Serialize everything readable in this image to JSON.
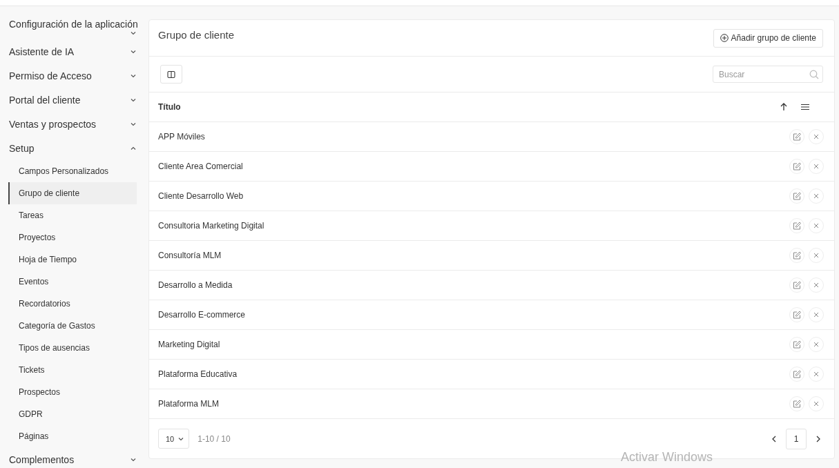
{
  "sidebar": {
    "items": [
      {
        "label": "Configuración de la aplicación",
        "expanded": false
      },
      {
        "label": "Asistente de IA",
        "expanded": false
      },
      {
        "label": "Permiso de Acceso",
        "expanded": false
      },
      {
        "label": "Portal del cliente",
        "expanded": false
      },
      {
        "label": "Ventas y prospectos",
        "expanded": false
      },
      {
        "label": "Setup",
        "expanded": true,
        "children": [
          {
            "label": "Campos Personalizados",
            "selected": false
          },
          {
            "label": "Grupo de cliente",
            "selected": true
          },
          {
            "label": "Tareas",
            "selected": false
          },
          {
            "label": "Proyectos",
            "selected": false
          },
          {
            "label": "Hoja de Tiempo",
            "selected": false
          },
          {
            "label": "Eventos",
            "selected": false
          },
          {
            "label": "Recordatorios",
            "selected": false
          },
          {
            "label": "Categoría de Gastos",
            "selected": false
          },
          {
            "label": "Tipos de ausencias",
            "selected": false
          },
          {
            "label": "Tickets",
            "selected": false
          },
          {
            "label": "Prospectos",
            "selected": false
          },
          {
            "label": "GDPR",
            "selected": false
          },
          {
            "label": "Páginas",
            "selected": false
          }
        ]
      },
      {
        "label": "Complementos",
        "expanded": false
      }
    ]
  },
  "card": {
    "title": "Grupo de cliente",
    "add_button": "Añadir grupo de cliente",
    "search": {
      "placeholder": "Buscar"
    },
    "table": {
      "columns": [
        "Título"
      ],
      "rows": [
        "APP Móviles",
        "Cliente Area Comercial",
        "Cliente Desarrollo Web",
        "Consultoria Marketing Digital",
        "Consultoría MLM",
        "Desarrollo a Medida",
        "Desarrollo E-commerce",
        "Marketing Digital",
        "Plataforma Educativa",
        "Plataforma MLM"
      ]
    },
    "pagination": {
      "page_size": "10",
      "range": "1-10 / 10",
      "pages": [
        {
          "label": "1",
          "selected": true
        }
      ]
    }
  },
  "os_overlay": "Activar Windows"
}
